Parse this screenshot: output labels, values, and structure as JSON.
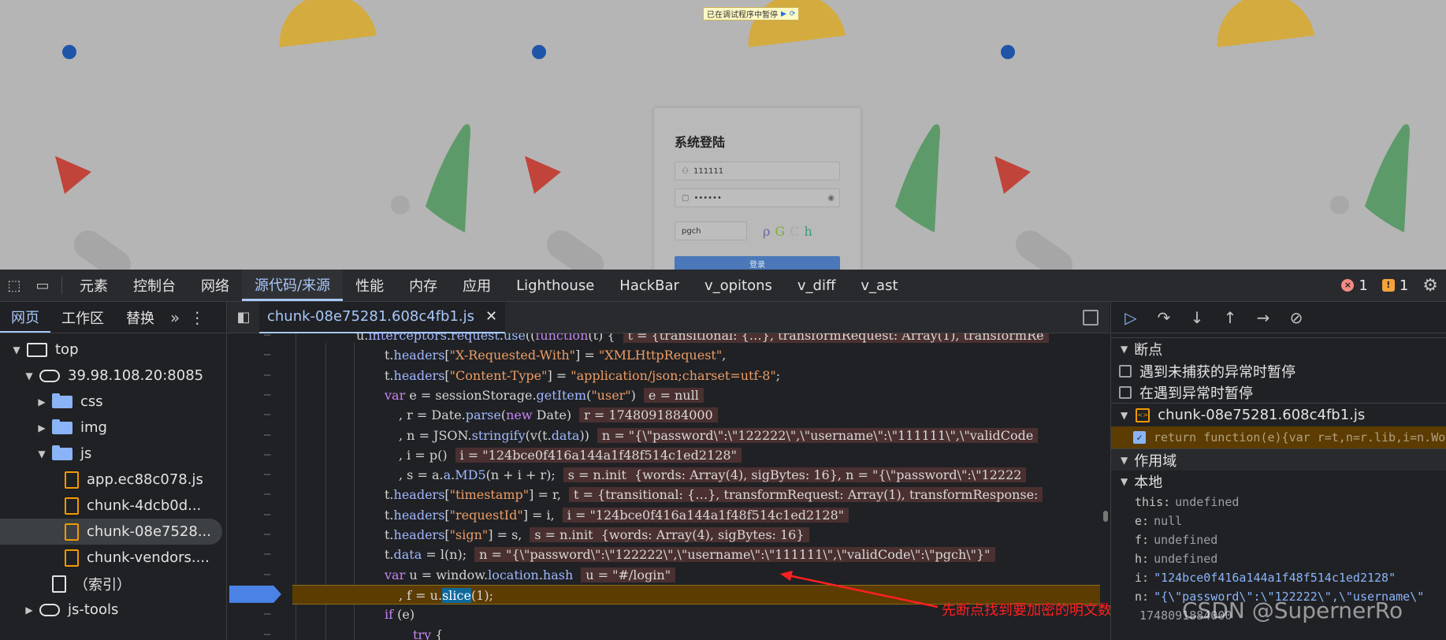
{
  "page": {
    "pause_banner": {
      "text": "已在调试程序中暂停",
      "resume_icon": "▶",
      "step_icon": "⟳"
    },
    "login": {
      "title": "系统登陆",
      "username_value": "111111",
      "password_value": "••••••",
      "captcha_value": "pgch",
      "captcha_chars": [
        "ρ",
        "G",
        "C",
        "h"
      ],
      "captcha_colors": [
        "#6a6a9a",
        "#7fae3a",
        "#aaaaaa",
        "#3c9a7a"
      ],
      "login_button": "登录"
    }
  },
  "devtools": {
    "tabs": [
      "元素",
      "控制台",
      "网络",
      "源代码/来源",
      "性能",
      "内存",
      "应用",
      "Lighthouse",
      "HackBar",
      "v_opitons",
      "v_diff",
      "v_ast"
    ],
    "active_tab": "源代码/来源",
    "error_count": "1",
    "warning_count": "1",
    "colors": {
      "accent": "#a8c7fa",
      "error": "#f28b82",
      "warning": "#f6a23a"
    }
  },
  "navigator": {
    "tabs": [
      "网页",
      "工作区",
      "替换"
    ],
    "more_icon": "»",
    "tree": [
      {
        "label": "top",
        "icon": "frame-icon",
        "indent": 0,
        "caret": "▼"
      },
      {
        "label": "39.98.108.20:8085",
        "icon": "cloud-icon",
        "indent": 1,
        "caret": "▼"
      },
      {
        "label": "css",
        "icon": "folder-icon",
        "indent": 2,
        "caret": "▶"
      },
      {
        "label": "img",
        "icon": "folder-icon",
        "indent": 2,
        "caret": "▶"
      },
      {
        "label": "js",
        "icon": "folder-icon",
        "indent": 2,
        "caret": "▼"
      },
      {
        "label": "app.ec88c078.js",
        "icon": "file-icon",
        "indent": 3,
        "caret": ""
      },
      {
        "label": "chunk-4dcb0d...",
        "icon": "file-icon",
        "indent": 3,
        "caret": ""
      },
      {
        "label": "chunk-08e7528...",
        "icon": "file-icon",
        "indent": 3,
        "caret": "",
        "selected": true
      },
      {
        "label": "chunk-vendors....",
        "icon": "file-icon",
        "indent": 3,
        "caret": ""
      },
      {
        "label": "（索引）",
        "icon": "file-icon-white",
        "indent": 2,
        "caret": ""
      },
      {
        "label": "js-tools",
        "icon": "cloud-icon",
        "indent": 1,
        "caret": "▶"
      }
    ]
  },
  "editor": {
    "file_tab": "chunk-08e75281.608c4fb1.js",
    "close_icon": "✕",
    "gutter_mark": "–",
    "lines": [
      {
        "indent": 0,
        "html_key": "l0",
        "val": "t = {transitional: {…}, transformRequest: Array(1), transformRe"
      },
      {
        "indent": 1,
        "html_key": "l1",
        "val": ""
      },
      {
        "indent": 1,
        "html_key": "l2",
        "val": ""
      },
      {
        "indent": 1,
        "html_key": "l3",
        "val": "e = null"
      },
      {
        "indent": 2,
        "html_key": "l4",
        "val": "r = 1748091884000"
      },
      {
        "indent": 2,
        "html_key": "l5",
        "val": "n = \"{\\\"password\\\":\\\"122222\\\",\\\"username\\\":\\\"111111\\\",\\\"validCode"
      },
      {
        "indent": 2,
        "html_key": "l6",
        "val": "i = \"124bce0f416a144a1f48f514c1ed2128\""
      },
      {
        "indent": 2,
        "html_key": "l7",
        "val": "s = n.init  {words: Array(4), sigBytes: 16}, n = \"{\\\"password\\\":\\\"12222"
      },
      {
        "indent": 1,
        "html_key": "l8",
        "val": "t = {transitional: {…}, transformRequest: Array(1), transformResponse:"
      },
      {
        "indent": 1,
        "html_key": "l9",
        "val": "i = \"124bce0f416a144a1f48f514c1ed2128\""
      },
      {
        "indent": 1,
        "html_key": "l10",
        "val": "s = n.init  {words: Array(4), sigBytes: 16}"
      },
      {
        "indent": 1,
        "html_key": "l11",
        "val": "n = \"{\\\"password\\\":\\\"122222\\\",\\\"username\\\":\\\"111111\\\",\\\"validCode\\\":\\\"pgch\\\"}\""
      },
      {
        "indent": 1,
        "html_key": "l12",
        "val": "u = \"#/login\""
      },
      {
        "indent": 2,
        "html_key": "l13",
        "val": ""
      },
      {
        "indent": 1,
        "html_key": "l14",
        "val": ""
      },
      {
        "indent": 2,
        "html_key": "l15",
        "val": ""
      }
    ],
    "code": {
      "l0a": "u.",
      "l0b": "interceptors",
      "l0c": ".",
      "l0d": "request",
      "l0e": ".",
      "l0f": "use",
      "l0g": "((",
      "l0h": "function",
      "l0i": "(t) {",
      "l1a": "t.",
      "l1b": "headers",
      "l1c": "[",
      "l1d": "\"X-Requested-With\"",
      "l1e": "] = ",
      "l1f": "\"XMLHttpRequest\"",
      "l1g": ",",
      "l2a": "t.",
      "l2b": "headers",
      "l2c": "[",
      "l2d": "\"Content-Type\"",
      "l2e": "] = ",
      "l2f": "\"application/json;charset=utf-8\"",
      "l2g": ";",
      "l3a": "var",
      "l3b": " e = sessionStorage.",
      "l3c": "getItem",
      "l3d": "(",
      "l3e": "\"user\"",
      "l3f": ")",
      "l4a": ", r = Date.",
      "l4b": "parse",
      "l4c": "(",
      "l4d": "new",
      "l4e": " Date)",
      "l5a": ", n = JSON.",
      "l5b": "stringify",
      "l5c": "(v(t.",
      "l5d": "data",
      "l5e": "))",
      "l6a": ", i = p()",
      "l7a": ", s = a.",
      "l7b": "a",
      "l7c": ".",
      "l7d": "MD5",
      "l7e": "(n + i + r);",
      "l8a": "t.",
      "l8b": "headers",
      "l8c": "[",
      "l8d": "\"timestamp\"",
      "l8e": "] = r,",
      "l9a": "t.",
      "l9b": "headers",
      "l9c": "[",
      "l9d": "\"requestId\"",
      "l9e": "] = i,",
      "l10a": "t.",
      "l10b": "headers",
      "l10c": "[",
      "l10d": "\"sign\"",
      "l10e": "] = s,",
      "l11a": "t.",
      "l11b": "data",
      "l11c": " = l(n);",
      "l12a": "var",
      "l12b": " u = window.",
      "l12c": "location",
      "l12d": ".",
      "l12e": "hash",
      "l13a": ", f = u.",
      "l13b": "slice",
      "l13c": "(1);",
      "l14a": "if",
      "l14b": " (e)",
      "l15a": "try",
      "l15b": " {"
    }
  },
  "annotation": {
    "text": "先断点找到要加密的明文数据"
  },
  "debugger": {
    "toolbar": {
      "resume": "resume-icon",
      "step_over": "step-over-icon",
      "step_into": "step-into-icon",
      "step_out": "step-out-icon",
      "step": "step-icon",
      "deactivate": "deactivate-breakpoints-icon"
    },
    "breakpoints_title": "断点",
    "pause_uncaught": "遇到未捕获的异常时暂停",
    "pause_caught": "在遇到异常时暂停",
    "bp_file": "chunk-08e75281.608c4fb1.js",
    "bp_line": "return function(e){var r=t,n=r.lib,i=n.Wo",
    "scope_title": "作用域",
    "local_title": "本地",
    "scope_vars": [
      {
        "key": "this:",
        "val": "undefined"
      },
      {
        "key": "e:",
        "val": "null"
      },
      {
        "key": "f:",
        "val": "undefined"
      },
      {
        "key": "h:",
        "val": "undefined"
      },
      {
        "key": "i:",
        "val": "\"124bce0f416a144a1f48f514c1ed2128\""
      },
      {
        "key": "n:",
        "val": "\"{\\\"password\\\":\\\"122222\\\",\\\"username\\\""
      },
      {
        "key": "",
        "val": "1748091884000"
      }
    ]
  },
  "watermark": "CSDN @SupernerRo"
}
